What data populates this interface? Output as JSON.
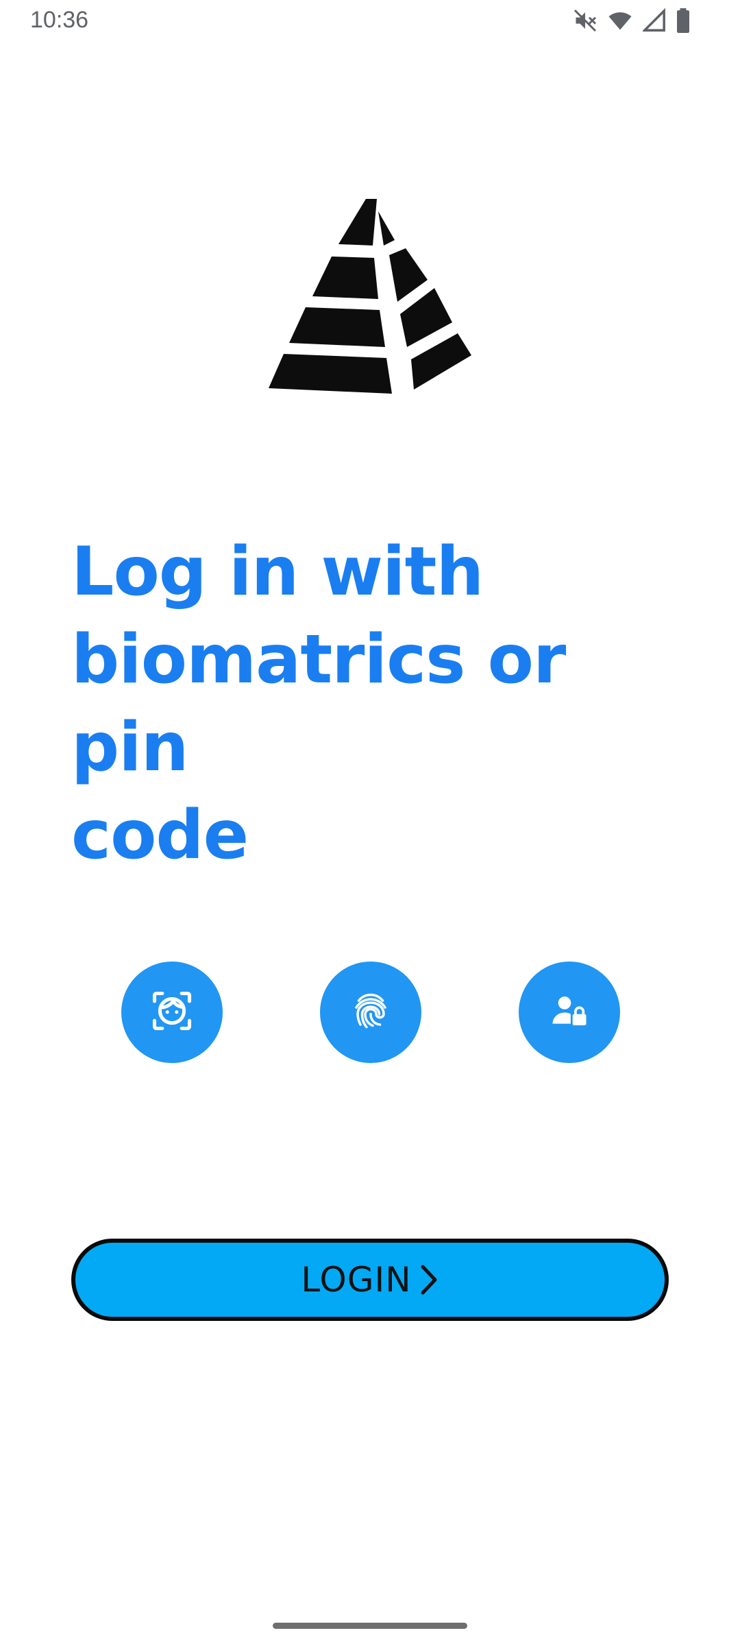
{
  "status_bar": {
    "time": "10:36",
    "icons": [
      "mute-icon",
      "wifi-icon",
      "cell-signal-icon",
      "battery-icon"
    ]
  },
  "logo": {
    "icon": "pyramid-logo"
  },
  "heading": {
    "line1": "Log in with",
    "line2": "biomatrics or pin",
    "line3": "code"
  },
  "biometrics": {
    "options": [
      {
        "icon": "face-id-icon"
      },
      {
        "icon": "fingerprint-icon"
      },
      {
        "icon": "user-lock-icon"
      }
    ],
    "button_color": "#2196f3"
  },
  "login": {
    "label": "LOGIN",
    "icon": "chevron-right-icon",
    "color": "#03a9f4"
  },
  "colors": {
    "heading": "#1a7ef0",
    "background": "#ffffff"
  }
}
